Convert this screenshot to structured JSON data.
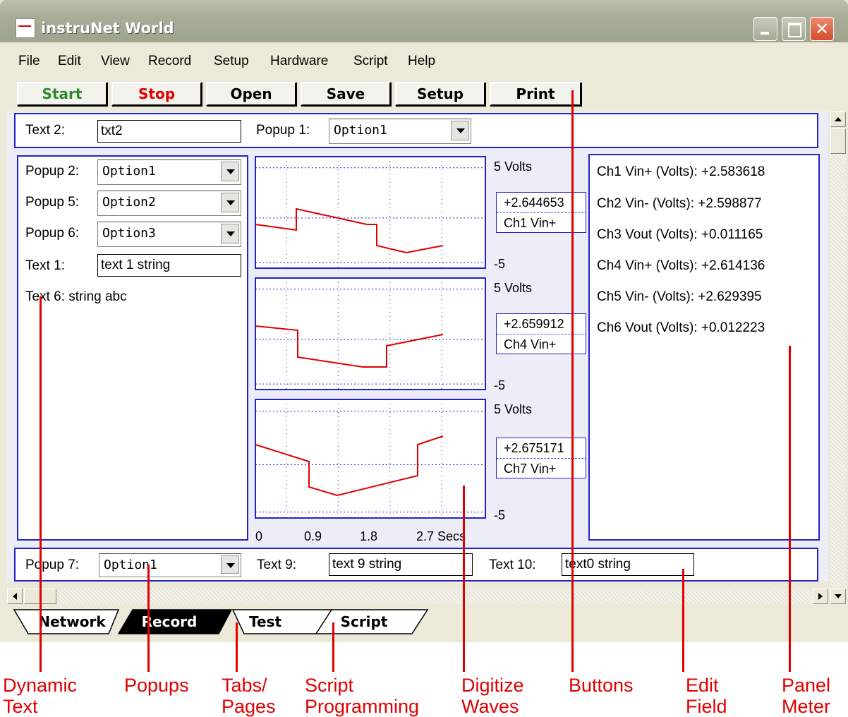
{
  "window": {
    "title": "instruNet World"
  },
  "menu": [
    "File",
    "Edit",
    "View",
    "Record",
    "Setup",
    "Hardware",
    "Script",
    "Help"
  ],
  "toolbar": {
    "start": "Start",
    "stop": "Stop",
    "open": "Open",
    "save": "Save",
    "setup": "Setup",
    "print": "Print",
    "start_color": "#2a8a2a",
    "stop_color": "#e00000"
  },
  "top_row": {
    "text2_label": "Text 2:",
    "text2_value": "txt2",
    "popup1_label": "Popup 1:",
    "popup1_value": "Option1"
  },
  "left_panel": {
    "popup2_label": "Popup 2:",
    "popup2_value": "Option1",
    "popup5_label": "Popup 5:",
    "popup5_value": "Option2",
    "popup6_label": "Popup 6:",
    "popup6_value": "Option3",
    "text1_label": "Text 1:",
    "text1_value": "text 1 string",
    "text6": "Text 6: string abc"
  },
  "charts": [
    {
      "scale_top": "5 Volts",
      "scale_bottom": "-5",
      "value": "+2.644653",
      "channel": "Ch1 Vin+"
    },
    {
      "scale_top": "5 Volts",
      "scale_bottom": "-5",
      "value": "+2.659912",
      "channel": "Ch4 Vin+"
    },
    {
      "scale_top": "5 Volts",
      "scale_bottom": "-5",
      "value": "+2.675171",
      "channel": "Ch7 Vin+"
    }
  ],
  "x_axis": {
    "ticks": [
      "0",
      "0.9",
      "1.8",
      "2.7 Secs"
    ]
  },
  "panel_meter": [
    "Ch1 Vin+ (Volts): +2.583618",
    "Ch2 Vin- (Volts): +2.598877",
    "Ch3 Vout (Volts): +0.011165",
    "Ch4 Vin+ (Volts): +2.614136",
    "Ch5 Vin- (Volts): +2.629395",
    "Ch6 Vout (Volts): +0.012223"
  ],
  "bottom_row": {
    "popup7_label": "Popup 7:",
    "popup7_value": "Option1",
    "text9_label": "Text 9:",
    "text9_value": "text 9 string",
    "text10_label": "Text 10:",
    "text10_value": "text0 string"
  },
  "tabs": [
    "Network",
    "Record",
    "Test",
    "Script"
  ],
  "active_tab": "Record",
  "annotations": [
    {
      "line1": "Dynamic",
      "line2": "Text"
    },
    {
      "line1": "Popups",
      "line2": ""
    },
    {
      "line1": "Tabs/",
      "line2": "Pages"
    },
    {
      "line1": "Script",
      "line2": "Programming"
    },
    {
      "line1": "Digitize",
      "line2": "Waves"
    },
    {
      "line1": "Buttons",
      "line2": ""
    },
    {
      "line1": "Edit",
      "line2": "Field"
    },
    {
      "line1": "Panel",
      "line2": "Meter"
    }
  ],
  "colors": {
    "accent_blue": "#2222cc",
    "annotation_red": "#e00000",
    "wave_red": "#e00000"
  }
}
